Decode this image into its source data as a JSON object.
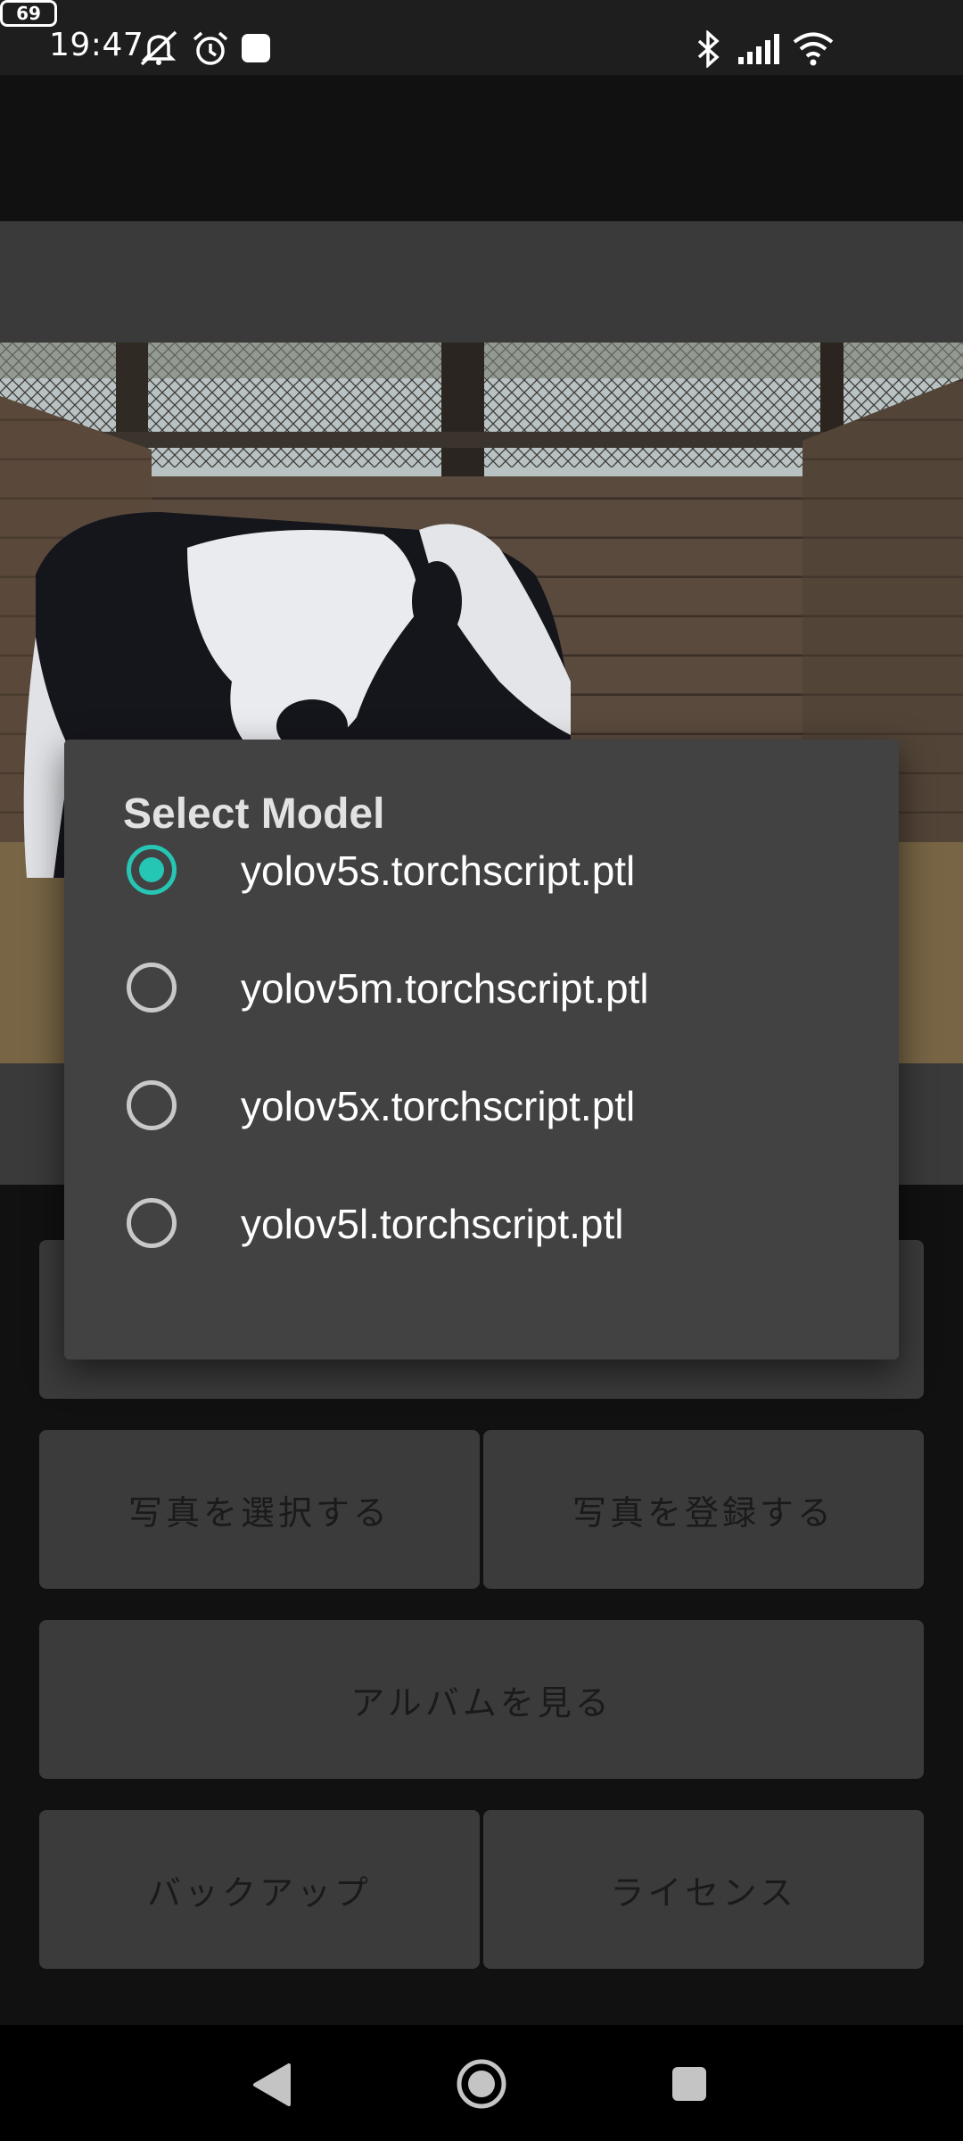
{
  "status_bar": {
    "time": "19:47",
    "battery": "69",
    "icons": [
      "mute-icon",
      "alarm-icon",
      "app-notification-icon",
      "bluetooth-icon",
      "signal-icon",
      "wifi-icon",
      "battery-icon"
    ]
  },
  "dialog": {
    "title": "Select Model",
    "options": [
      {
        "label": "yolov5s.torchscript.ptl",
        "checked": true
      },
      {
        "label": "yolov5m.torchscript.ptl",
        "checked": false
      },
      {
        "label": "yolov5x.torchscript.ptl",
        "checked": false
      },
      {
        "label": "yolov5l.torchscript.ptl",
        "checked": false
      }
    ],
    "accent_color": "#26c6b5"
  },
  "buttons": {
    "select_photo": "写真を選択する",
    "register_photo": "写真を登録する",
    "view_album": "アルバムを見る",
    "backup": "バックアップ",
    "license": "ライセンス"
  },
  "nav_bar": {
    "icons": [
      "back-icon",
      "home-icon",
      "recents-icon"
    ]
  }
}
